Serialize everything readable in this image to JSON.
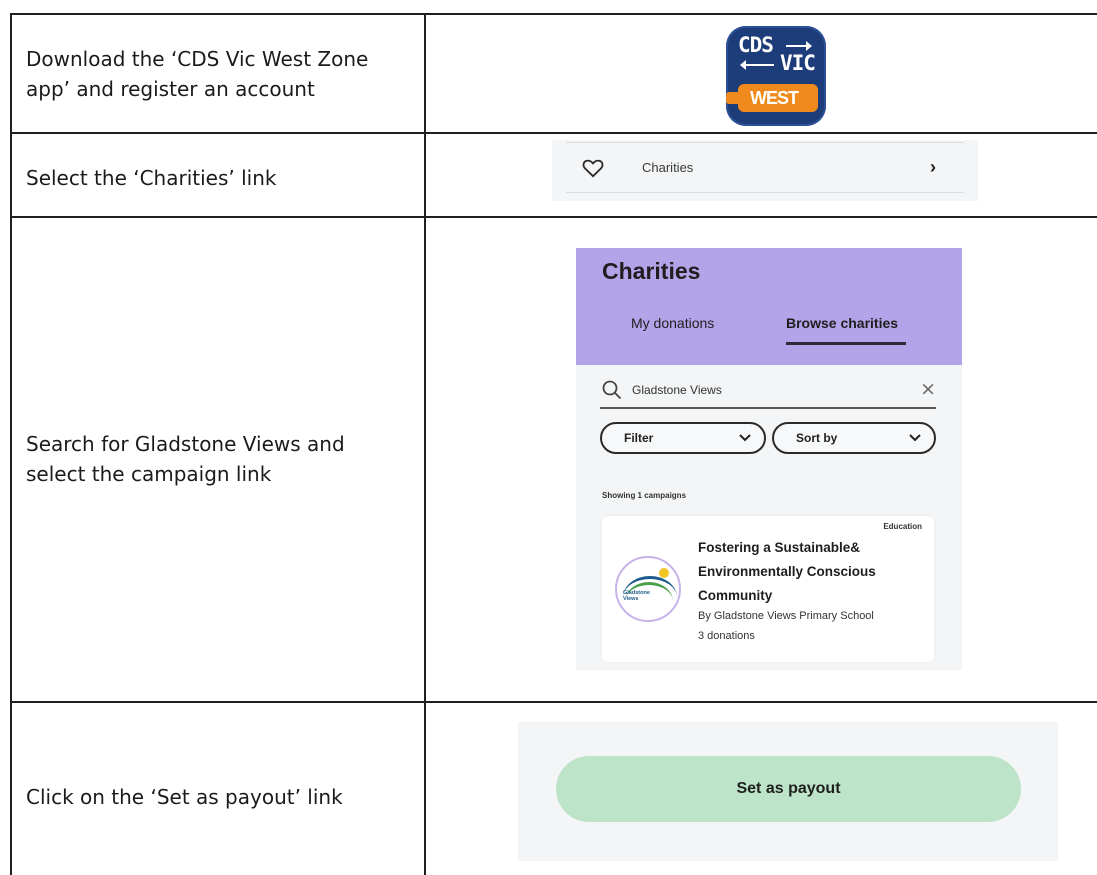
{
  "steps": [
    {
      "text": "Download the ‘CDS Vic West Zone app’ and register an account"
    },
    {
      "text": "Select the ‘Charities’ link"
    },
    {
      "text": "Search for Gladstone Views and select the campaign link"
    },
    {
      "text": "Click on the ‘Set as payout’ link"
    }
  ],
  "app_icon": {
    "line1": "CDS",
    "line2": "VIC",
    "badge": "WEST",
    "colors": {
      "background": "#1d3c7a",
      "bottle": "#f08a1c"
    }
  },
  "charities_link": {
    "icon": "heart-icon",
    "label": "Charities",
    "chevron": "›"
  },
  "charities_screen": {
    "title": "Charities",
    "tabs": [
      {
        "label": "My donations",
        "active": false
      },
      {
        "label": "Browse charities",
        "active": true
      }
    ],
    "search": {
      "value": "Gladstone Views",
      "clear_icon": "×"
    },
    "filters": {
      "filter_label": "Filter",
      "sort_label": "Sort by"
    },
    "results_count": "Showing 1 campaigns",
    "campaign": {
      "category": "Education",
      "title": "Fostering a Sustainable& Environmentally Conscious Community",
      "by": "By Gladstone Views Primary School",
      "donations": "3 donations",
      "logo_text": "Gladstone Views"
    },
    "colors": {
      "header": "#b3a4ea",
      "background": "#f3f5f6"
    }
  },
  "payout": {
    "button_label": "Set as payout",
    "colors": {
      "button": "#bde4c8"
    }
  }
}
